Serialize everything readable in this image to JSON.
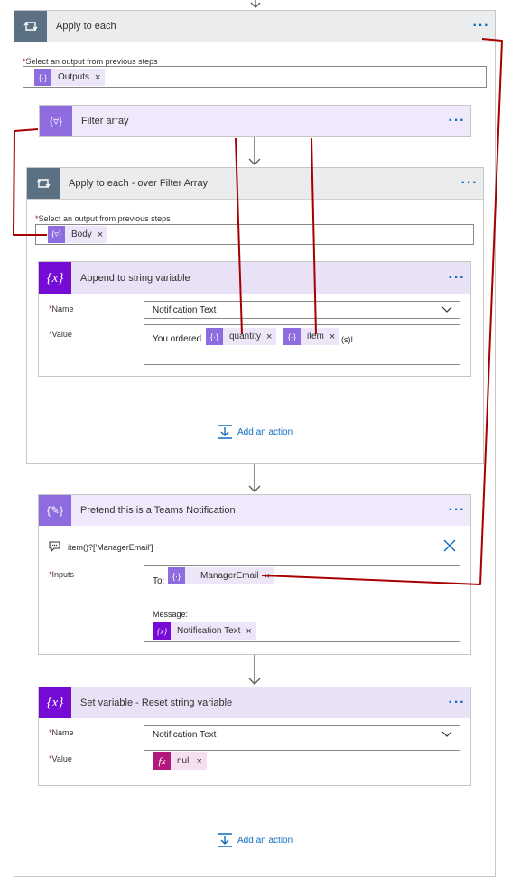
{
  "apply_each": {
    "title": "Apply to each",
    "select_label": "Select an output from previous steps",
    "token": "Outputs"
  },
  "filter": {
    "title": "Filter array"
  },
  "apply_filter": {
    "title": "Apply to each - over Filter Array",
    "select_label": "Select an output from previous steps",
    "token": "Body"
  },
  "append": {
    "title": "Append to string variable",
    "name_label": "Name",
    "name_value": "Notification Text",
    "value_label": "Value",
    "value_prefix": "You ordered",
    "token1": "quantity",
    "token2": "item",
    "value_suffix": "(s)!"
  },
  "inner_add": {
    "label": "Add an action"
  },
  "teams": {
    "title": "Pretend this is a Teams Notification",
    "param_text": "item()?['ManagerEmail']",
    "inputs_label": "Inputs",
    "to_label": "To:",
    "to_token": "ManagerEmail",
    "message_label": "Message:",
    "message_token": "Notification Text"
  },
  "setvar": {
    "title": "Set variable - Reset string variable",
    "name_label": "Name",
    "name_value": "Notification Text",
    "value_label": "Value",
    "value_token": "null"
  },
  "outer_add": {
    "label": "Add an action"
  },
  "colors": {
    "accent": "#0f6cbd",
    "annotation": "#a80000",
    "token_bg": "#ece6f8",
    "dynamic": "#8f6be0",
    "variable": "#770bd6",
    "expression": "#b1187b"
  }
}
